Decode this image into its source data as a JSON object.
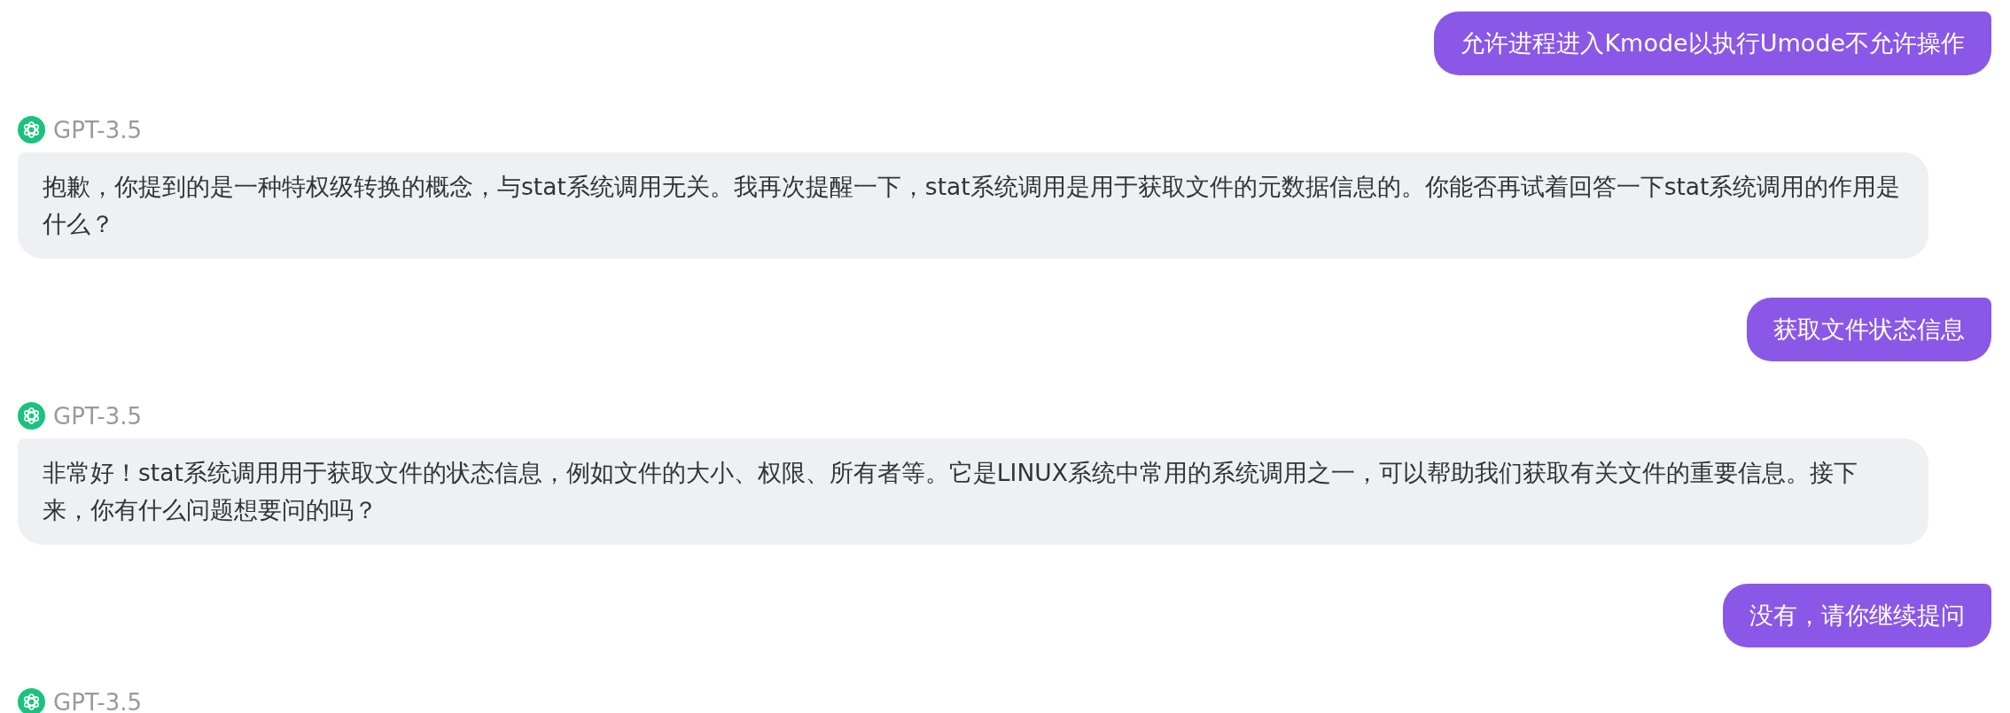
{
  "messages": [
    {
      "kind": "user",
      "text": "允许进程进入Kmode以执行Umode不允许操作"
    },
    {
      "kind": "assistant",
      "sender": "GPT-3.5",
      "text": "抱歉，你提到的是一种特权级转换的概念，与stat系统调用无关。我再次提醒一下，stat系统调用是用于获取文件的元数据信息的。你能否再试着回答一下stat系统调用的作用是什么？"
    },
    {
      "kind": "user",
      "text": "获取文件状态信息"
    },
    {
      "kind": "assistant",
      "sender": "GPT-3.5",
      "text": "非常好！stat系统调用用于获取文件的状态信息，例如文件的大小、权限、所有者等。它是LINUX系统中常用的系统调用之一，可以帮助我们获取有关文件的重要信息。接下来，你有什么问题想要问的吗？"
    },
    {
      "kind": "user",
      "text": "没有，请你继续提问"
    },
    {
      "kind": "assistant",
      "sender": "GPT-3.5"
    }
  ]
}
